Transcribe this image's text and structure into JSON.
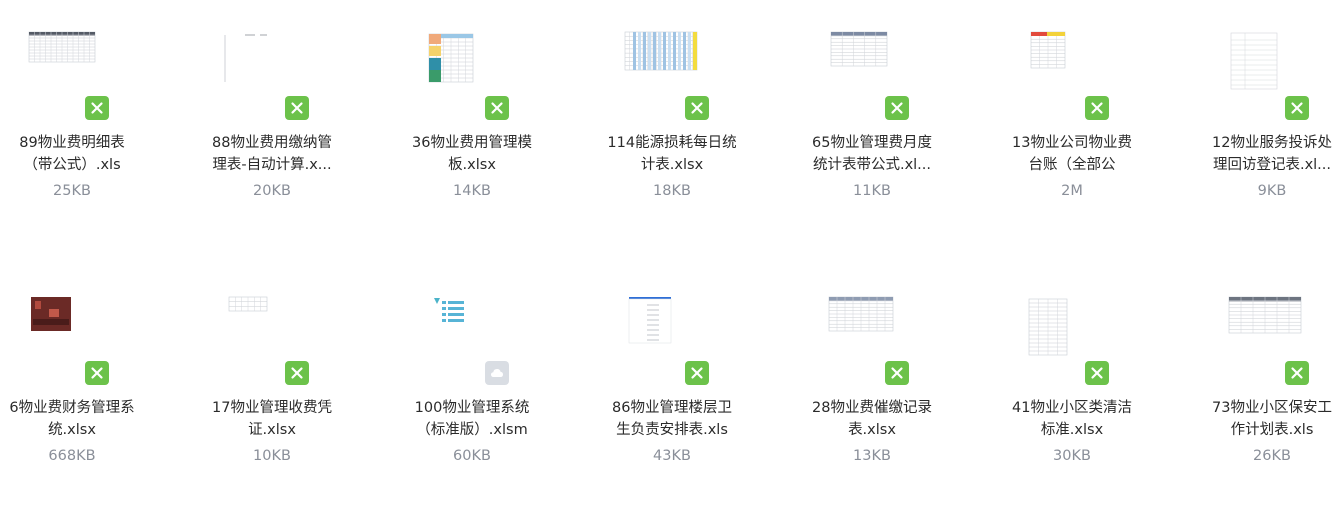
{
  "files": [
    {
      "name_lines": [
        "89物业费明细表",
        "（带公式）.xls"
      ],
      "size": "25KB",
      "type": "excel"
    },
    {
      "name_lines": [
        "88物业费用缴纳管",
        "理表-自动计算.x..."
      ],
      "size": "20KB",
      "type": "excel"
    },
    {
      "name_lines": [
        "36物业费用管理模",
        "板.xlsx"
      ],
      "size": "14KB",
      "type": "excel"
    },
    {
      "name_lines": [
        "114能源损耗每日统",
        "计表.xlsx"
      ],
      "size": "18KB",
      "type": "excel"
    },
    {
      "name_lines": [
        "65物业管理费月度",
        "统计表带公式.xl..."
      ],
      "size": "11KB",
      "type": "excel"
    },
    {
      "name_lines": [
        "13物业公司物业费",
        "台账（全部公"
      ],
      "size": "2M",
      "type": "excel"
    },
    {
      "name_lines": [
        "12物业服务投诉处",
        "理回访登记表.xl..."
      ],
      "size": "9KB",
      "type": "excel"
    },
    {
      "name_lines": [
        "6物业费财务管理系",
        "统.xlsx"
      ],
      "size": "668KB",
      "type": "excel"
    },
    {
      "name_lines": [
        "17物业管理收费凭",
        "证.xlsx"
      ],
      "size": "10KB",
      "type": "excel"
    },
    {
      "name_lines": [
        "100物业管理系统",
        "（标准版）.xlsm"
      ],
      "size": "60KB",
      "type": "cloud"
    },
    {
      "name_lines": [
        "86物业管理楼层卫",
        "生负责安排表.xls"
      ],
      "size": "43KB",
      "type": "excel"
    },
    {
      "name_lines": [
        "28物业费催缴记录",
        "表.xlsx"
      ],
      "size": "13KB",
      "type": "excel"
    },
    {
      "name_lines": [
        "41物业小区类清洁",
        "标准.xlsx"
      ],
      "size": "30KB",
      "type": "excel"
    },
    {
      "name_lines": [
        "73物业小区保安工",
        "作计划表.xls"
      ],
      "size": "26KB",
      "type": "excel"
    }
  ],
  "colors": {
    "excel_badge": "#6cc24a",
    "cloud_badge": "#d9dde3",
    "size_text": "#8a8f99"
  },
  "icons": {
    "excel": "excel-x-icon",
    "cloud": "cloud-icon"
  }
}
